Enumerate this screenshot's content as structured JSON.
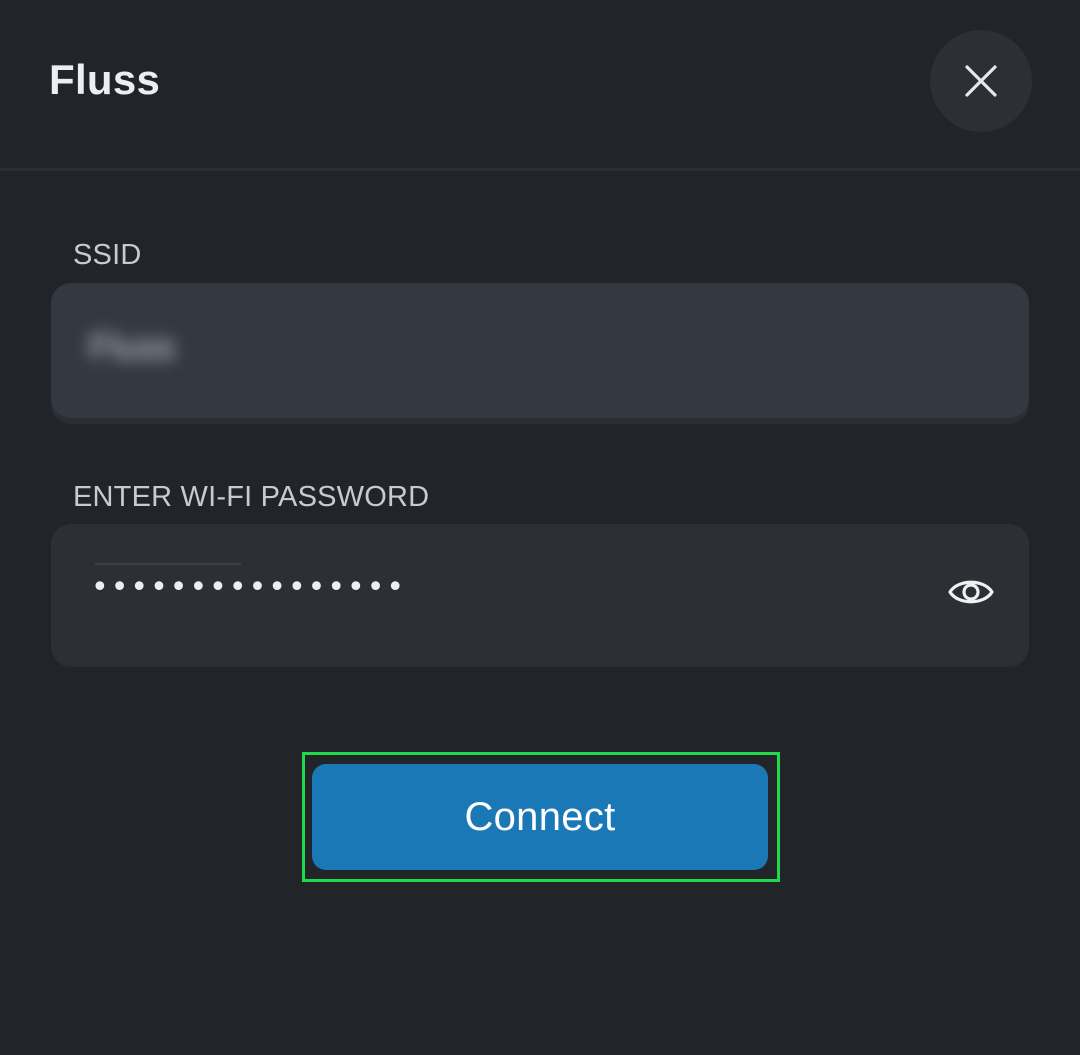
{
  "header": {
    "title": "Fluss",
    "close_icon": "close-icon"
  },
  "form": {
    "ssid": {
      "label": "SSID",
      "value": "Fluss"
    },
    "password": {
      "label": "ENTER WI-FI PASSWORD",
      "masked_value": "••••••••••••••••",
      "visibility_icon": "eye-icon"
    },
    "connect_label": "Connect"
  },
  "colors": {
    "background": "#212429",
    "field_background": "#343840",
    "button_accent": "#1b78b6",
    "highlight_border": "#22d94a"
  }
}
